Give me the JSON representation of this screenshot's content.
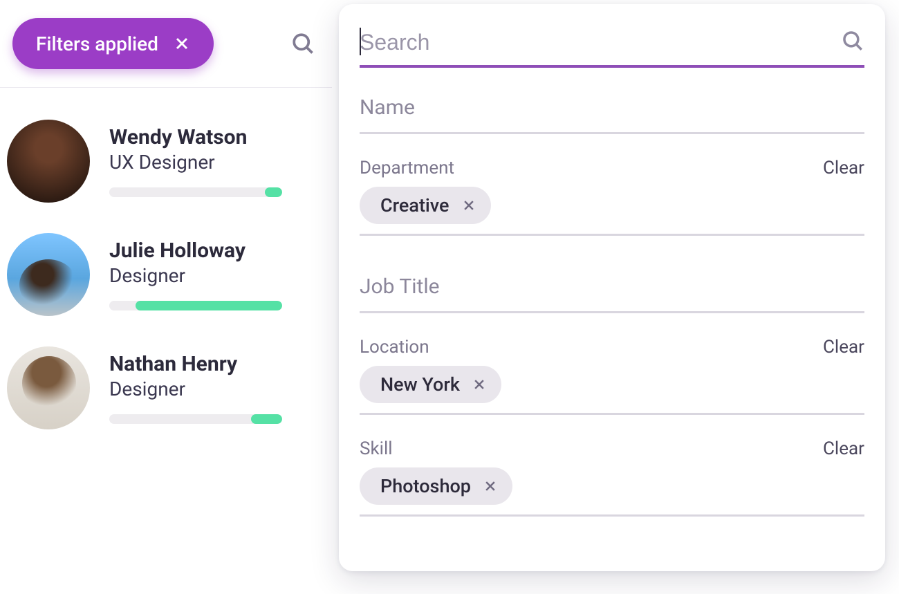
{
  "sidebar": {
    "filters_chip_label": "Filters applied",
    "people": [
      {
        "name": "Wendy Watson",
        "title": "UX Designer",
        "progress_pct": 10
      },
      {
        "name": "Julie Holloway",
        "title": "Designer",
        "progress_pct": 85
      },
      {
        "name": "Nathan Henry",
        "title": "Designer",
        "progress_pct": 18
      }
    ]
  },
  "panel": {
    "search_placeholder": "Search",
    "clear_label": "Clear",
    "fields": {
      "name": {
        "label": "Name"
      },
      "department": {
        "label": "Department",
        "chips": [
          "Creative"
        ]
      },
      "job_title": {
        "label": "Job Title"
      },
      "location": {
        "label": "Location",
        "chips": [
          "New York"
        ]
      },
      "skill": {
        "label": "Skill",
        "chips": [
          "Photoshop"
        ]
      }
    }
  },
  "icons": {
    "search": "search-icon",
    "close": "close-icon"
  }
}
